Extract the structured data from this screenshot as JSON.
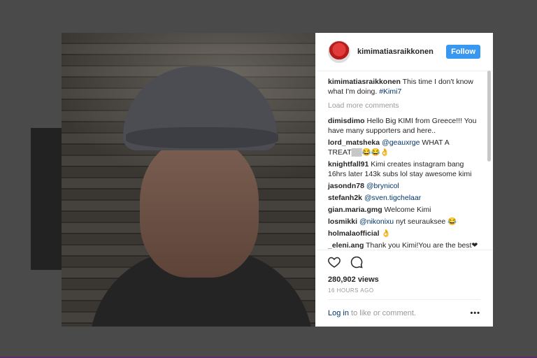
{
  "post": {
    "username": "kimimatiasraikkonen",
    "follow_label": "Follow",
    "caption": {
      "user": "kimimatiasraikkonen",
      "text": "This time I don't know what I'm doing.",
      "hashtag": "#Kimi7"
    },
    "load_more_label": "Load more comments",
    "comments": [
      {
        "user": "dimisdimo",
        "mention": "",
        "text": "Hello Big KIMI from Greece!!! You have many supporters and here.."
      },
      {
        "user": "lord_matsheka",
        "mention": "@geauxrge",
        "text": "WHAT A TREAT▒▒😂😂👌"
      },
      {
        "user": "knightfall91",
        "mention": "",
        "text": "Kimi creates instagram bang 16hrs later 143k subs lol stay awesome kimi"
      },
      {
        "user": "jasondn78",
        "mention": "@brynicol",
        "text": ""
      },
      {
        "user": "stefanh2k",
        "mention": "@sven.tigchelaar",
        "text": ""
      },
      {
        "user": "gian.maria.gmg",
        "mention": "",
        "text": "Welcome Kimi"
      },
      {
        "user": "losmikki",
        "mention": "@nikonixu",
        "text": "nyt seurauksee 😂"
      },
      {
        "user": "holmalaofficial",
        "mention": "",
        "text": "👌"
      },
      {
        "user": "_eleni.ang",
        "mention": "",
        "text": "Thank you Kimi!You are the best❤❤❤"
      }
    ],
    "views": "280,902 views",
    "time_ago": "16 HOURS AGO",
    "login_label": "Log in",
    "login_suffix": "to like or comment.",
    "more_label": "•••"
  }
}
